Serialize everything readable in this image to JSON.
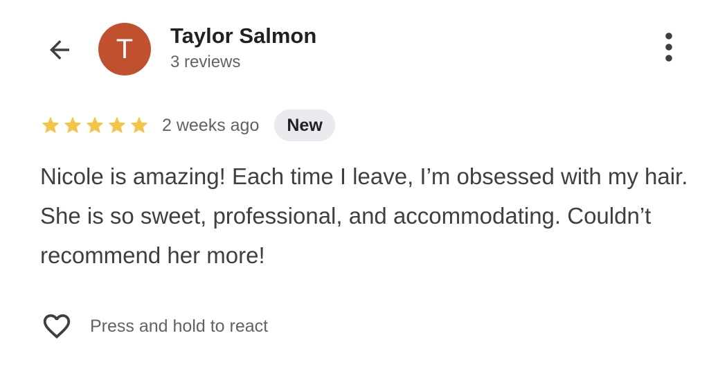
{
  "header": {
    "back_icon": "arrow-back-icon",
    "avatar_initial": "T",
    "reviewer_name": "Taylor Salmon",
    "review_count": "3 reviews",
    "more_icon": "more-vert-icon"
  },
  "rating": {
    "stars": 5,
    "max_stars": 5,
    "time_ago": "2 weeks ago",
    "badge": "New"
  },
  "review": {
    "text": "Nicole is amazing! Each time I leave, I’m obsessed with my hair. She is so sweet, professional, and accommodating. Couldn’t recommend her more!"
  },
  "react": {
    "icon": "heart-outline-icon",
    "label": "Press and hold to react"
  },
  "colors": {
    "avatar_bg": "#c1502e",
    "star": "#f4c542",
    "badge_bg": "#e8eaed",
    "icon": "#3c4043"
  }
}
